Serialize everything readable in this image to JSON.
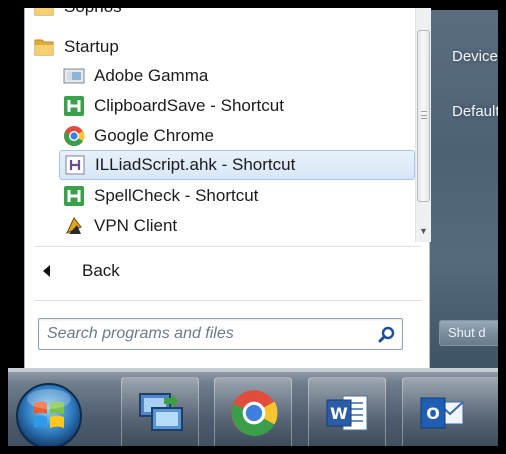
{
  "start_menu": {
    "programs": [
      {
        "label": "Sophos",
        "icon": "folder-icon"
      },
      {
        "label": "Startup",
        "icon": "folder-icon"
      },
      {
        "label": "Adobe Gamma",
        "icon": "adobe-gamma-icon"
      },
      {
        "label": "ClipboardSave - Shortcut",
        "icon": "autohotkey-icon"
      },
      {
        "label": "Google Chrome",
        "icon": "chrome-icon"
      },
      {
        "label": "ILLiadScript.ahk - Shortcut",
        "icon": "ahk-script-icon",
        "selected": true
      },
      {
        "label": "SpellCheck - Shortcut",
        "icon": "autohotkey-icon"
      },
      {
        "label": "VPN Client",
        "icon": "vpn-client-icon"
      }
    ],
    "back_label": "Back",
    "search": {
      "placeholder": "Search programs and files",
      "value": ""
    },
    "right_column": {
      "items": [
        "Devices",
        "Default"
      ],
      "shutdown_label": "Shut d"
    }
  },
  "taskbar": {
    "start_button": "windows-start-orb",
    "pinned": [
      {
        "name": "remote-desktop",
        "icon": "remote-desktop-icon"
      },
      {
        "name": "google-chrome",
        "icon": "chrome-icon"
      },
      {
        "name": "microsoft-word",
        "icon": "word-icon",
        "letter": "W"
      },
      {
        "name": "microsoft-outlook",
        "icon": "outlook-icon",
        "letter": "O"
      }
    ]
  },
  "colors": {
    "selection_bg": "#d8e7f8",
    "selection_border": "#a8c6ea",
    "taskbar": "#4d5c6d",
    "glass": "#566a7e"
  }
}
